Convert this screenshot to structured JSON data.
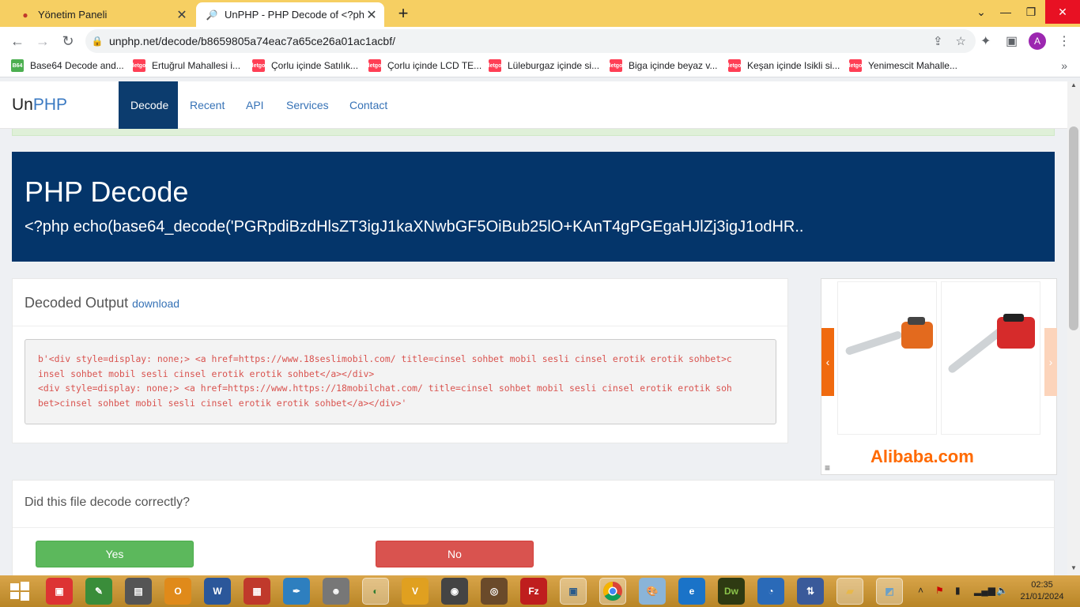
{
  "browser": {
    "tabs": [
      {
        "title": "Yönetim Paneli",
        "active": false
      },
      {
        "title": "UnPHP - PHP Decode of <?php e",
        "active": true
      }
    ],
    "url": "unphp.net/decode/b8659805a74eac7a65ce26a01ac1acbf/",
    "profile_initial": "A",
    "bookmarks": [
      {
        "label": "Base64 Decode and...",
        "icon": "B64",
        "color": "#4caf50"
      },
      {
        "label": "Ertuğrul Mahallesi i...",
        "icon": "letgo",
        "color": "#ff3f55"
      },
      {
        "label": "Çorlu içinde Satılık...",
        "icon": "letgo",
        "color": "#ff3f55"
      },
      {
        "label": "Çorlu içinde LCD TE...",
        "icon": "letgo",
        "color": "#ff3f55"
      },
      {
        "label": "Lüleburgaz içinde si...",
        "icon": "letgo",
        "color": "#ff3f55"
      },
      {
        "label": "Biga içinde beyaz v...",
        "icon": "letgo",
        "color": "#ff3f55"
      },
      {
        "label": "Keşan içinde Isikli si...",
        "icon": "letgo",
        "color": "#ff3f55"
      },
      {
        "label": "Yenimescit Mahalle...",
        "icon": "letgo",
        "color": "#ff3f55"
      }
    ]
  },
  "site": {
    "brand_un": "Un",
    "brand_php": "PHP",
    "nav": [
      "Decode",
      "Recent",
      "API",
      "Services",
      "Contact"
    ]
  },
  "hero": {
    "title": "PHP Decode",
    "code": "<?php echo(base64_decode('PGRpdiBzdHlsZT3igJ1kaXNwbGF5OiBub25lO+KAnT4gPGEgaHJlZj3igJ1odHR.."
  },
  "output": {
    "heading": "Decoded Output",
    "download": "download",
    "lines": [
      "b'<div style=display: none;> <a href=https://www.18seslimobil.com/ title=cinsel sohbet mobil sesli cinsel erotik erotik sohbet>c",
      "insel sohbet mobil sesli cinsel erotik erotik sohbet</a></div>",
      "<div style=display: none;> <a href=https://www.https://18mobilchat.com/ title=cinsel sohbet mobil sesli cinsel erotik erotik soh",
      "bet>cinsel sohbet mobil sesli cinsel erotik erotik sohbet</a></div>'"
    ]
  },
  "ad": {
    "logo": "Alibaba.com",
    "menu_icon": "≡"
  },
  "feedback": {
    "question": "Did this file decode correctly?",
    "yes": "Yes",
    "no": "No"
  },
  "taskbar": {
    "time": "02:35",
    "date": "21/01/2024"
  }
}
